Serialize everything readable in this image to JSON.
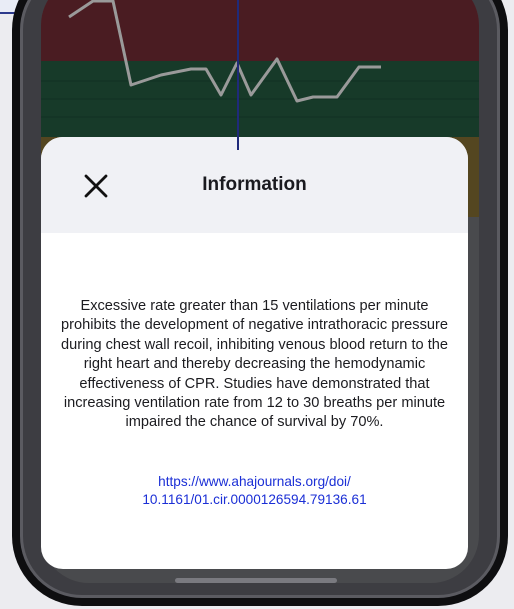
{
  "modal": {
    "title": "Information",
    "close_icon": "close-icon",
    "body": "Excessive rate greater than 15 ventilations per minute prohibits the development of negative intrathoracic pressure during chest wall recoil, inhibiting venous blood return to the right heart and thereby decreasing the hemodynamic effectiveness of CPR. Studies have demonstrated that increasing ventilation rate from 12 to 30 breaths per minute impaired the chance of survival by 70%.",
    "link": "https://www.ahajournals.org/doi/10.1161/01.cir.0000126594.79136.61"
  },
  "colors": {
    "band_high": "#4a1c22",
    "band_target": "#173a29",
    "band_low": "#544620",
    "trace": "#9a9a9a",
    "link": "#1b2fd6"
  }
}
